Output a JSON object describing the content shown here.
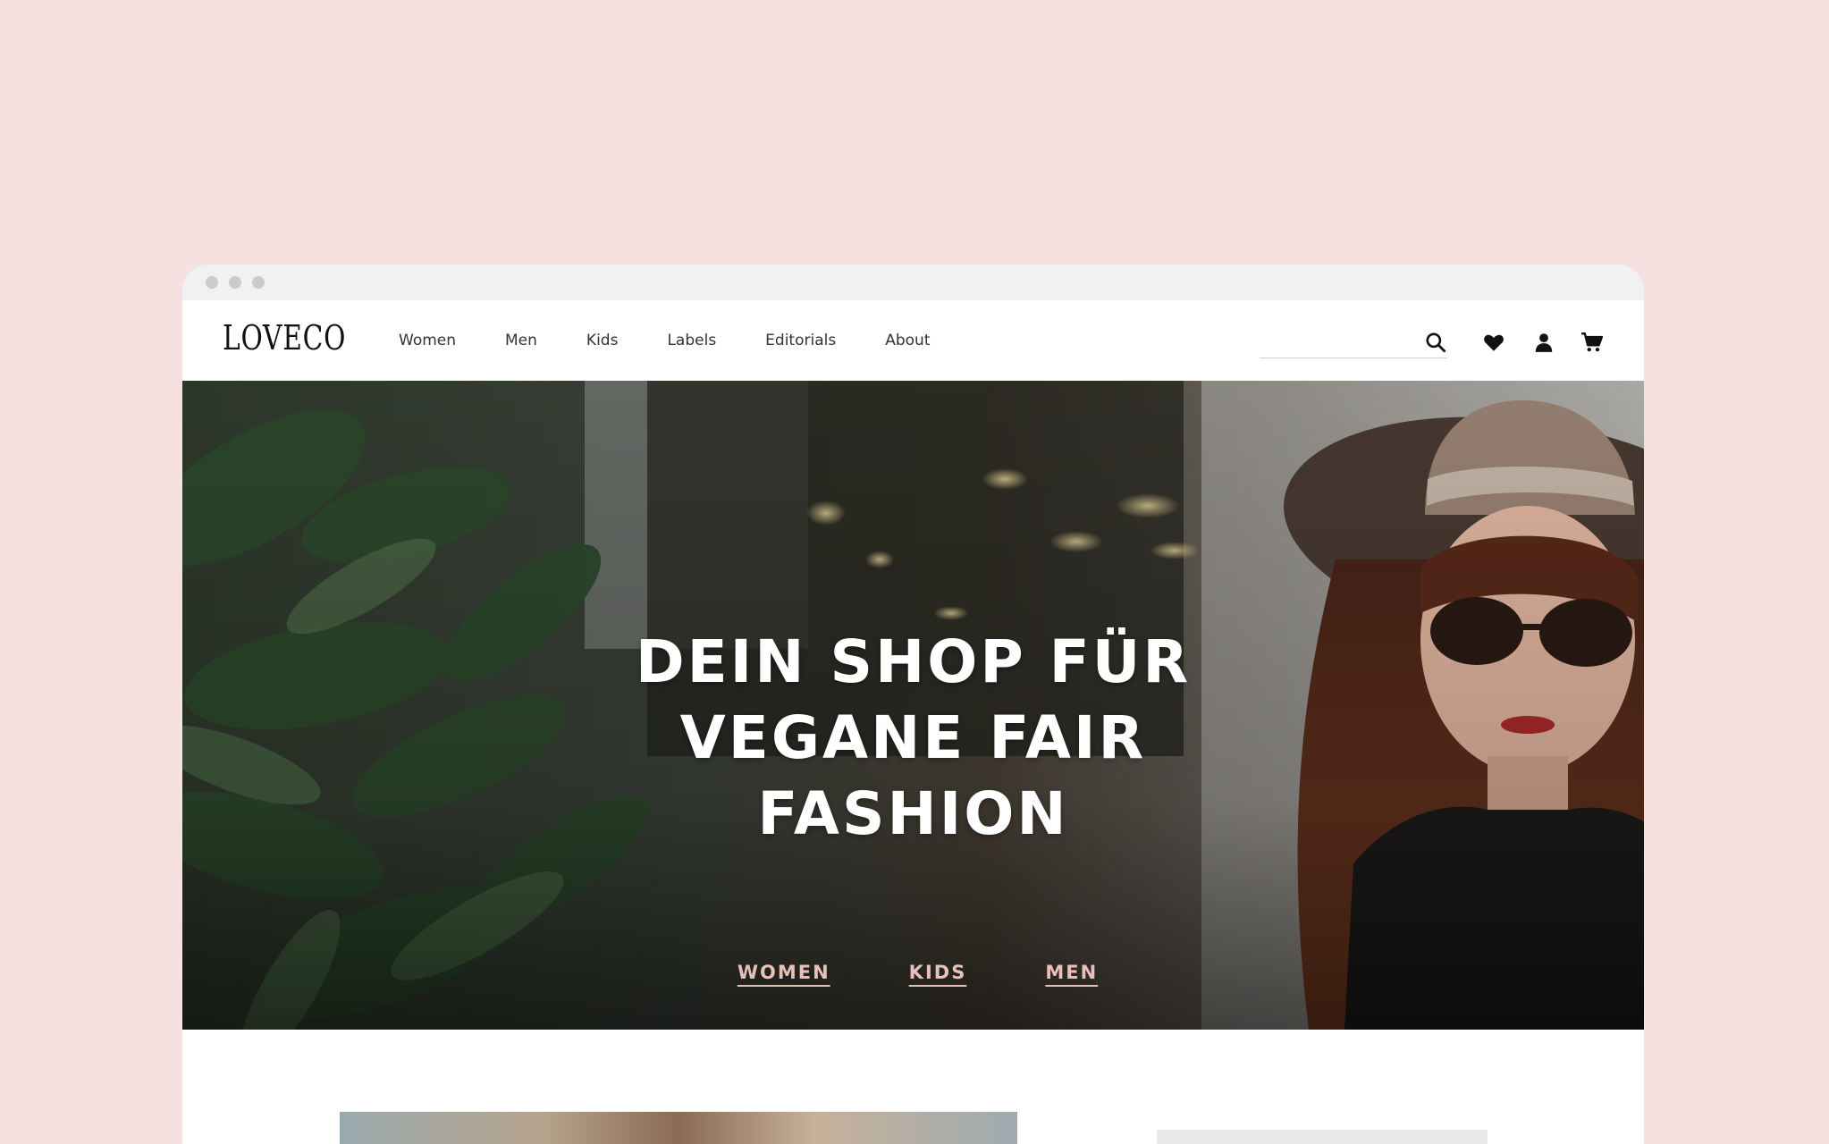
{
  "browser": {
    "window_controls": [
      "close-dot",
      "minimize-dot",
      "maximize-dot"
    ]
  },
  "header": {
    "logo": "LOVECO",
    "nav": [
      {
        "label": "Women"
      },
      {
        "label": "Men"
      },
      {
        "label": "Kids"
      },
      {
        "label": "Labels"
      },
      {
        "label": "Editorials"
      },
      {
        "label": "About"
      }
    ],
    "search": {
      "placeholder": "",
      "value": ""
    },
    "icons": [
      "search-icon",
      "heart-icon",
      "user-icon",
      "cart-icon"
    ]
  },
  "hero": {
    "title_lines": [
      "DEIN SHOP FÜR",
      "VEGANE FAIR",
      "FASHION"
    ],
    "links": [
      {
        "label": "WOMEN"
      },
      {
        "label": "KIDS"
      },
      {
        "label": "MEN"
      }
    ]
  },
  "colors": {
    "page_background": "#f4e1e0",
    "hero_link": "#e7c0b9",
    "titlebar": "#f0f1f1"
  }
}
